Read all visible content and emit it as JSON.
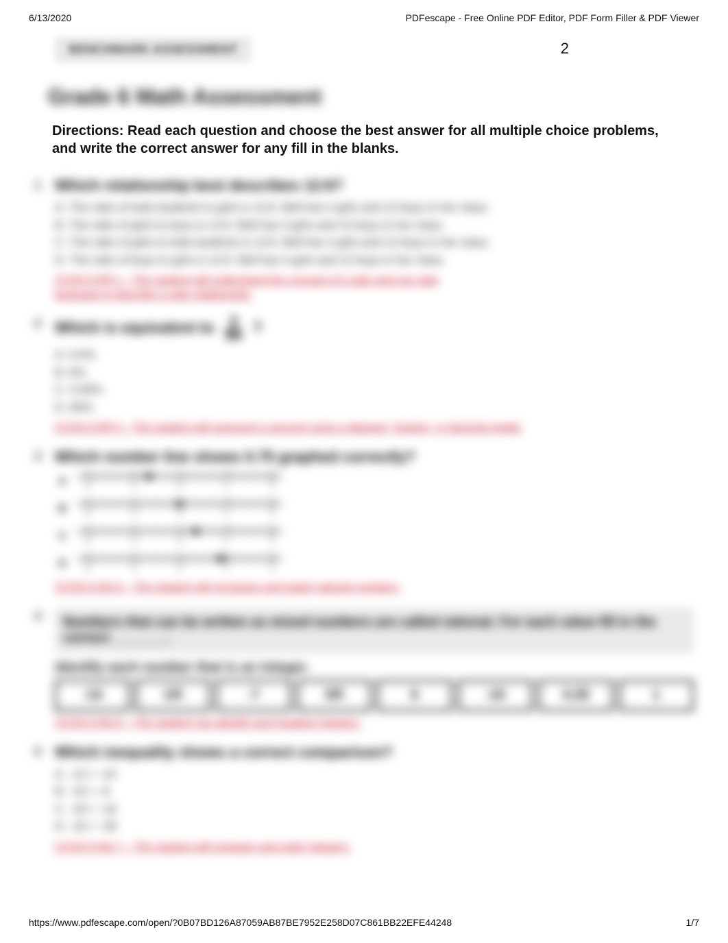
{
  "top": {
    "date": "6/13/2020",
    "app_title": "PDFescape - Free Online PDF Editor, PDF Form Filler & PDF Viewer"
  },
  "page_number": "2",
  "header_band": "BENCHMARK ASSESSMENT",
  "title": "Grade 6 Math Assessment",
  "directions": "Directions: Read each question and choose the best answer for all multiple choice problems, and write the correct answer for any fill in the blanks.",
  "q1": {
    "num": "1",
    "prompt": "Which relationship best describes 12:6?",
    "choices": [
      "A. The ratio of total students to girls is 12:6.   Bell has 4 girls and 12 boys in her class.",
      "B. The ratio of girls to boys is 12:6.   Bell has 4 girls and 12 boys in her class.",
      "C. The ratio of girls to total students is 12:6.   Bell has 4 girls and 12 boys in her class.",
      "D. The ratio of boys to girls is 12:6.   Bell has 4 girls and 12 boys in her class."
    ],
    "answer_line1": "CCSS 6.RP.1 – The student will understand the concept of a ratio and use ratio",
    "answer_line2": "language to describe a ratio relationship."
  },
  "q2": {
    "num": "2",
    "prompt_left": "Which is equivalent to",
    "frac_num": "3",
    "frac_den": "50",
    "prompt_right": "?",
    "choices": [
      "A. 6.0%",
      "B. 6%",
      "C. 0.06%",
      "D. 60%"
    ],
    "answer": "CCSS 6.RP.3 – The student will represent a percent using a diagram, fraction, or decimal model."
  },
  "q3": {
    "num": "3",
    "prompt": "Which number line shows 0.75 graphed correctly?",
    "letters": [
      "A",
      "B",
      "C",
      "D"
    ],
    "labels": [
      "-2",
      "-1",
      "0",
      "1",
      "2"
    ],
    "dots_pct": [
      35,
      50,
      58,
      70
    ],
    "answer": "CCSS 6.NS.6 – The student will recognize and graph rational numbers."
  },
  "q4": {
    "num": "4",
    "prompt_a": "Numbers that can be written as mixed numbers are called rational. For each value fill in the correct _______.",
    "prompt_b": "Identify each number that is an integer.",
    "cells": [
      "-14",
      "1/5",
      "-7",
      "3/5",
      "6",
      "-10",
      "4.29",
      "1"
    ],
    "answer": "CCSS 6.NS.6 – The student can identify and negative integers."
  },
  "q5": {
    "num": "5",
    "prompt": "Which inequality shows a correct comparison?",
    "choices": [
      "A.  -13 > -10",
      "B.   -10 > -8",
      "C.   -20 > -16",
      "D.   -22 < -30"
    ],
    "answer": "CCSS 6.NS.7 – The student will compare and order integers."
  },
  "footer": {
    "url": "https://www.pdfescape.com/open/?0B07BD126A87059AB87BE7952E258D07C861BB22EFE44248",
    "page_of": "1/7"
  }
}
